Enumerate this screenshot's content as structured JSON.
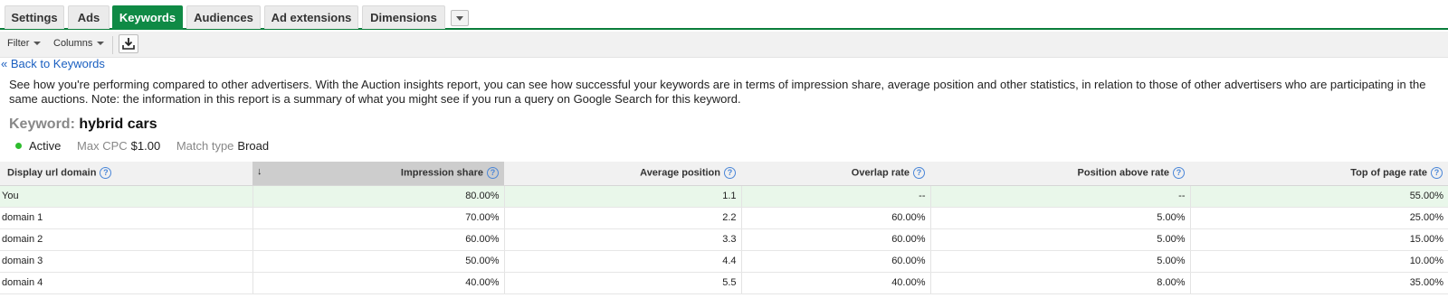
{
  "tabs": [
    {
      "label": "Settings",
      "active": false
    },
    {
      "label": "Ads",
      "active": false
    },
    {
      "label": "Keywords",
      "active": true
    },
    {
      "label": "Audiences",
      "active": false
    },
    {
      "label": "Ad extensions",
      "active": false
    },
    {
      "label": "Dimensions",
      "active": false
    }
  ],
  "toolbar": {
    "filter_label": "Filter",
    "columns_label": "Columns"
  },
  "back_link": "« Back to Keywords",
  "description": "See how you're performing compared to other advertisers. With the Auction insights report, you can see how successful your keywords are in terms of impression share, average position and other statistics, in relation to those of other advertisers who are participating in the same auctions. Note: the information in this report is a summary of what you might see if you run a query on Google Search for this keyword.",
  "keyword": {
    "label": "Keyword:",
    "value": "hybrid cars",
    "status": "Active",
    "max_cpc_label": "Max CPC",
    "max_cpc": "$1.00",
    "match_type_label": "Match type",
    "match_type": "Broad"
  },
  "table": {
    "columns": [
      "Display url domain",
      "Impression share",
      "Average position",
      "Overlap rate",
      "Position above rate",
      "Top of page rate"
    ],
    "help_glyph": "?",
    "sort_glyph": "↓",
    "rows": [
      [
        "You",
        "80.00%",
        "1.1",
        "--",
        "--",
        "55.00%"
      ],
      [
        "domain 1",
        "70.00%",
        "2.2",
        "60.00%",
        "5.00%",
        "25.00%"
      ],
      [
        "domain 2",
        "60.00%",
        "3.3",
        "60.00%",
        "5.00%",
        "15.00%"
      ],
      [
        "domain 3",
        "50.00%",
        "4.4",
        "60.00%",
        "5.00%",
        "10.00%"
      ],
      [
        "domain 4",
        "40.00%",
        "5.5",
        "40.00%",
        "8.00%",
        "35.00%"
      ]
    ]
  },
  "colors": {
    "accent": "#0f8a45",
    "link": "#1a5fc0",
    "status_active": "#2ebc2e",
    "you_row": "#e9f7ea"
  }
}
